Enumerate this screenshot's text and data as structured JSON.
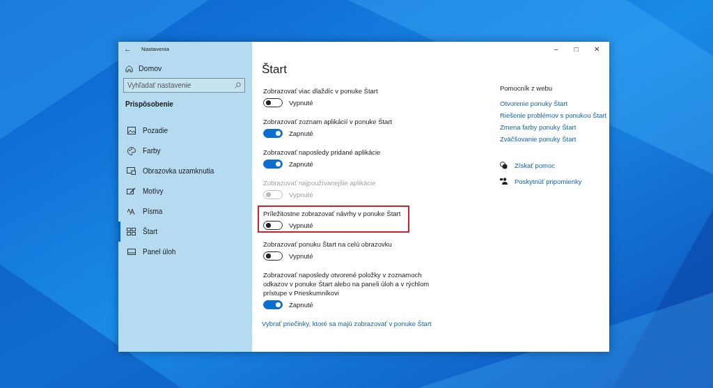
{
  "window": {
    "title": "Nastavenia",
    "back_icon": "←",
    "controls": [
      "–",
      "□",
      "✕"
    ]
  },
  "sidebar": {
    "home": "Domov",
    "search": {
      "placeholder": "Vyhľadať nastavenie"
    },
    "section": "Prispôsobenie",
    "items": [
      {
        "label": "Pozadie",
        "selected": false
      },
      {
        "label": "Farby",
        "selected": false
      },
      {
        "label": "Obrazovka uzamknutia",
        "selected": false
      },
      {
        "label": "Motívy",
        "selected": false
      },
      {
        "label": "Písma",
        "selected": false
      },
      {
        "label": "Štart",
        "selected": true
      },
      {
        "label": "Panel úloh",
        "selected": false
      }
    ]
  },
  "content": {
    "title": "Štart",
    "settings": [
      {
        "label": "Zobrazovať viac dlaždíc v ponuke Štart",
        "state": "Vypnuté",
        "on": false,
        "disabled": false,
        "highlighted": false
      },
      {
        "label": "Zobrazovať zoznam aplikácií v ponuke Štart",
        "state": "Zapnuté",
        "on": true,
        "disabled": false,
        "highlighted": false
      },
      {
        "label": "Zobrazovať naposledy pridané aplikácie",
        "state": "Zapnuté",
        "on": true,
        "disabled": false,
        "highlighted": false
      },
      {
        "label": "Zobrazovať najpoužívanejšie aplikácie",
        "state": "Vypnuté",
        "on": false,
        "disabled": true,
        "highlighted": false
      },
      {
        "label": "Príležitostne zobrazovať návrhy v ponuke Štart",
        "state": "Vypnuté",
        "on": false,
        "disabled": false,
        "highlighted": true
      },
      {
        "label": "Zobrazovať ponuku Štart na celú obrazovku",
        "state": "Vypnuté",
        "on": false,
        "disabled": false,
        "highlighted": false
      },
      {
        "label": "Zobrazovať naposledy otvorené položky v zoznamoch odkazov v ponuke Štart alebo na paneli úloh a v rýchlom prístupe v Prieskumníkovi",
        "state": "Zapnuté",
        "on": true,
        "disabled": false,
        "highlighted": false
      }
    ],
    "link": "Vybrať priečinky, ktoré sa majú zobrazovať v ponuke Štart"
  },
  "help": {
    "title": "Pomocník z webu",
    "links": [
      "Otvorenie ponuky Štart",
      "Riešenie problémov s ponukou Štart",
      "Zmena farby ponuky Štart",
      "Zväčšovanie ponuky Štart"
    ],
    "actions": [
      "Získať pomoc",
      "Poskytnúť pripomienky"
    ]
  }
}
